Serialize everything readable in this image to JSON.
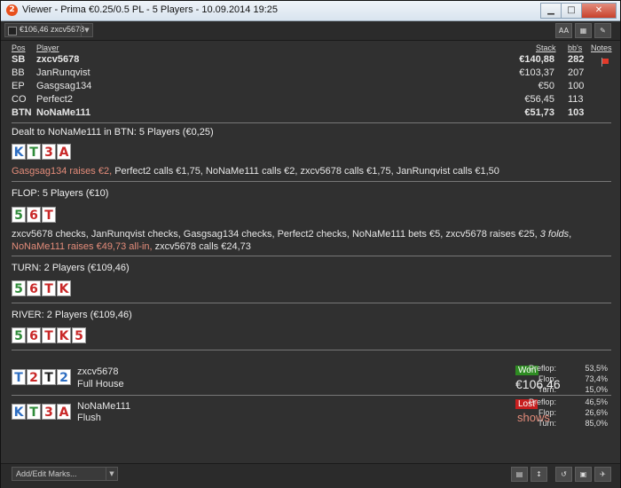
{
  "window": {
    "title": "Viewer - Prima €0.25/0.5 PL - 5 Players - 10.09.2014 19:25",
    "app_icon": "2",
    "min_icon": "minimize-icon",
    "max_icon": "maximize-icon",
    "close_icon": "close-icon"
  },
  "toolbar": {
    "hand_select_value": "€106,46 zxcv5678",
    "font_toggle_label": "AA"
  },
  "players_header": {
    "pos": "Pos",
    "player": "Player",
    "stack": "Stack",
    "bbs": "bb's",
    "notes": "Notes"
  },
  "players": [
    {
      "pos": "SB",
      "name": "zxcv5678",
      "stack": "€140,88",
      "bbs": "282",
      "bold": true
    },
    {
      "pos": "BB",
      "name": "JanRunqvist",
      "stack": "€103,37",
      "bbs": "207",
      "bold": false
    },
    {
      "pos": "EP",
      "name": "Gasgsag134",
      "stack": "€50",
      "bbs": "100",
      "bold": false
    },
    {
      "pos": "CO",
      "name": "Perfect2",
      "stack": "€56,45",
      "bbs": "113",
      "bold": false
    },
    {
      "pos": "BTN",
      "name": "NoNaMe111",
      "stack": "€51,73",
      "bbs": "103",
      "bold": true
    }
  ],
  "preflop": {
    "title": "Dealt to NoNaMe111 in BTN: 5 Players (€0,25)",
    "cards": [
      {
        "r": "K",
        "s": "blue"
      },
      {
        "r": "T",
        "s": "green"
      },
      {
        "r": "3",
        "s": "red"
      },
      {
        "r": "A",
        "s": "red"
      }
    ],
    "actions_hl": "Gasgsag134 raises €2,",
    "actions_rest": " Perfect2 calls €1,75, NoNaMe111 calls €2, zxcv5678 calls €1,75, JanRunqvist calls €1,50"
  },
  "flop": {
    "title": "FLOP: 5 Players (€10)",
    "cards": [
      {
        "r": "5",
        "s": "green"
      },
      {
        "r": "6",
        "s": "red"
      },
      {
        "r": "T",
        "s": "red"
      }
    ],
    "actions_a": "zxcv5678 checks, JanRunqvist checks, Gasgsag134 checks, Perfect2 checks, NoNaMe111 bets €5, zxcv5678 raises €25, ",
    "actions_folds": "3 folds",
    "actions_b": ", ",
    "actions_hl": "NoNaMe111 raises €49,73 all-in,",
    "actions_c": " zxcv5678 calls €24,73"
  },
  "turn": {
    "title": "TURN: 2 Players (€109,46)",
    "cards": [
      {
        "r": "5",
        "s": "green"
      },
      {
        "r": "6",
        "s": "red"
      },
      {
        "r": "T",
        "s": "red"
      },
      {
        "r": "K",
        "s": "red"
      }
    ]
  },
  "river": {
    "title": "RIVER: 2 Players (€109,46)",
    "cards": [
      {
        "r": "5",
        "s": "green"
      },
      {
        "r": "6",
        "s": "red"
      },
      {
        "r": "T",
        "s": "red"
      },
      {
        "r": "K",
        "s": "red"
      },
      {
        "r": "5",
        "s": "red"
      }
    ]
  },
  "showdown": [
    {
      "cards": [
        {
          "r": "T",
          "s": "blue"
        },
        {
          "r": "2",
          "s": "red"
        },
        {
          "r": "T",
          "s": "black"
        },
        {
          "r": "2",
          "s": "blue"
        }
      ],
      "name": "zxcv5678",
      "hand": "Full House",
      "badge": "Won",
      "result": "€106,46",
      "stats": [
        {
          "l": "Preflop:",
          "v": "53,5%"
        },
        {
          "l": "Flop:",
          "v": "73,4%"
        },
        {
          "l": "Turn:",
          "v": "15,0%"
        }
      ]
    },
    {
      "cards": [
        {
          "r": "K",
          "s": "blue"
        },
        {
          "r": "T",
          "s": "green"
        },
        {
          "r": "3",
          "s": "red"
        },
        {
          "r": "A",
          "s": "red"
        }
      ],
      "name": "NoNaMe111",
      "hand": "Flush",
      "badge": "Lost",
      "result": "shows",
      "stats": [
        {
          "l": "Preflop:",
          "v": "46,5%"
        },
        {
          "l": "Flop:",
          "v": "26,6%"
        },
        {
          "l": "Turn:",
          "v": "85,0%"
        }
      ]
    }
  ],
  "statusbar": {
    "marks_placeholder": "Add/Edit Marks..."
  },
  "colors": {
    "highlight": "#e48c7a",
    "won": "#2e8b22",
    "lost": "#c71f1f",
    "background": "#303030"
  }
}
